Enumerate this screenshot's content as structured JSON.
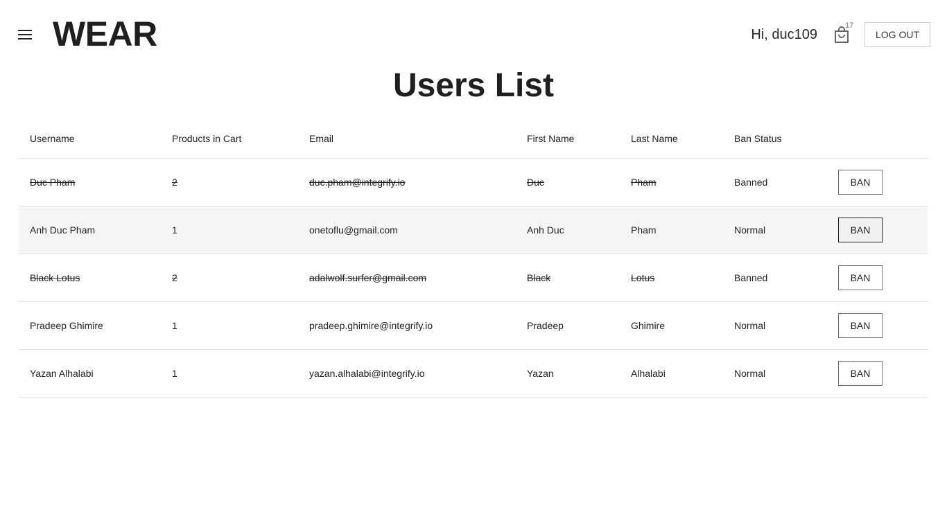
{
  "header": {
    "logo": "WEAR",
    "greeting": "Hi, duc109",
    "cart_count": "17",
    "logout_label": "LOG OUT"
  },
  "page": {
    "title": "Users List"
  },
  "table": {
    "columns": [
      "Username",
      "Products in Cart",
      "Email",
      "First Name",
      "Last Name",
      "Ban Status",
      ""
    ],
    "ban_label": "BAN",
    "rows": [
      {
        "username": "Duc Pham",
        "products": "2",
        "email": "duc.pham@integrify.io",
        "first": "Duc",
        "last": "Pham",
        "status": "Banned"
      },
      {
        "username": "Anh Duc Pham",
        "products": "1",
        "email": "onetoflu@gmail.com",
        "first": "Anh Duc",
        "last": "Pham",
        "status": "Normal"
      },
      {
        "username": "Black Lotus",
        "products": "2",
        "email": "adalwolf.surfer@gmail.com",
        "first": "Black",
        "last": "Lotus",
        "status": "Banned"
      },
      {
        "username": "Pradeep Ghimire",
        "products": "1",
        "email": "pradeep.ghimire@integrify.io",
        "first": "Pradeep",
        "last": "Ghimire",
        "status": "Normal"
      },
      {
        "username": "Yazan Alhalabi",
        "products": "1",
        "email": "yazan.alhalabi@integrify.io",
        "first": "Yazan",
        "last": "Alhalabi",
        "status": "Normal"
      }
    ]
  },
  "colors": {
    "banned": "#e53935",
    "normal": "#2e7d32"
  },
  "icons": {
    "menu": "hamburger-menu-icon",
    "cart": "shopping-bag-icon"
  }
}
